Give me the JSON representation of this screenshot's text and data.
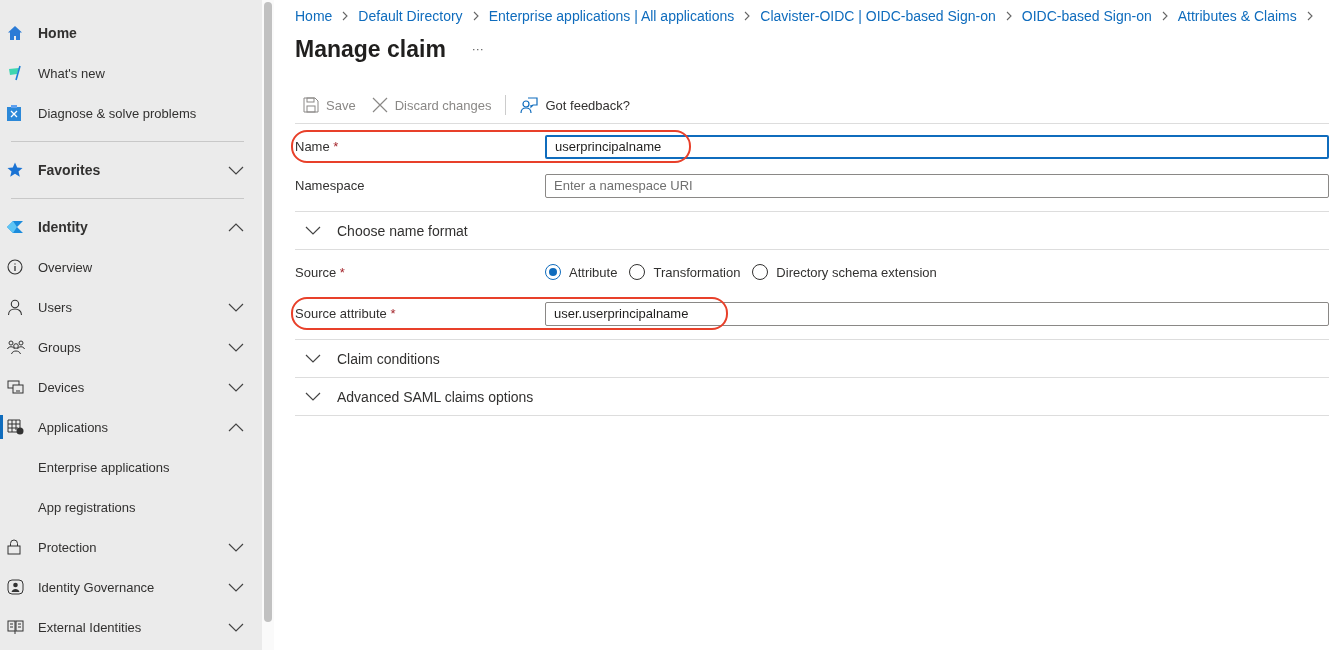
{
  "sidebar": {
    "items": [
      {
        "kind": "section",
        "label": "Home",
        "selected": false
      },
      {
        "kind": "item",
        "label": "What's new",
        "selected": false
      },
      {
        "kind": "item",
        "label": "Diagnose & solve problems",
        "selected": false
      },
      {
        "kind": "divider"
      },
      {
        "kind": "section",
        "label": "Favorites",
        "expanded": false,
        "selected": false
      },
      {
        "kind": "divider"
      },
      {
        "kind": "section",
        "label": "Identity",
        "expanded": true,
        "selected": false
      },
      {
        "kind": "item",
        "label": "Overview",
        "selected": false
      },
      {
        "kind": "item",
        "label": "Users",
        "expanded": false,
        "selected": false
      },
      {
        "kind": "item",
        "label": "Groups",
        "expanded": false,
        "selected": false
      },
      {
        "kind": "item",
        "label": "Devices",
        "expanded": false,
        "selected": false
      },
      {
        "kind": "item",
        "label": "Applications",
        "expanded": true,
        "selected": true
      },
      {
        "kind": "subitem",
        "label": "Enterprise applications",
        "selected": false
      },
      {
        "kind": "subitem",
        "label": "App registrations",
        "selected": false
      },
      {
        "kind": "item",
        "label": "Protection",
        "expanded": false,
        "selected": false
      },
      {
        "kind": "item",
        "label": "Identity Governance",
        "expanded": false,
        "selected": false
      },
      {
        "kind": "item",
        "label": "External Identities",
        "expanded": false,
        "selected": false
      }
    ]
  },
  "breadcrumb": [
    "Home",
    "Default Directory",
    "Enterprise applications | All applications",
    "Clavister-OIDC | OIDC-based Sign-on",
    "OIDC-based Sign-on",
    "Attributes & Claims"
  ],
  "title": "Manage claim",
  "more": "···",
  "toolbar": [
    {
      "label": "Save",
      "disabled": true
    },
    {
      "label": "Discard changes",
      "disabled": true
    },
    {
      "label": "Got feedback?",
      "disabled": false
    }
  ],
  "form": [
    {
      "kind": "field",
      "label": "Name",
      "required_mark": "*",
      "value": "userprincipalname",
      "focused": true,
      "highlighted": true
    },
    {
      "kind": "field",
      "label": "Namespace",
      "placeholder": "Enter a namespace URI",
      "focused": false,
      "highlighted": false
    },
    {
      "kind": "section",
      "label": "Choose name format",
      "expanded": false
    },
    {
      "kind": "radio",
      "label": "Source",
      "required_mark": "*",
      "options": [
        {
          "label": "Attribute",
          "selected": true
        },
        {
          "label": "Transformation",
          "selected": false
        },
        {
          "label": "Directory schema extension",
          "selected": false
        }
      ]
    },
    {
      "kind": "field",
      "label": "Source attribute",
      "required_mark": "*",
      "value": "user.userprincipalname",
      "focused": false,
      "highlighted": true
    },
    {
      "kind": "section",
      "label": "Claim conditions",
      "expanded": false
    },
    {
      "kind": "section",
      "label": "Advanced SAML claims options",
      "expanded": false
    }
  ]
}
